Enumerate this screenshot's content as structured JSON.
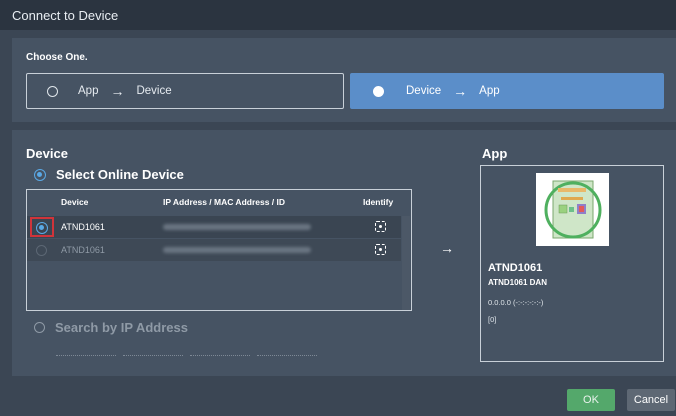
{
  "window": {
    "title": "Connect to Device"
  },
  "choose": {
    "label": "Choose One.",
    "app_to_device": {
      "from": "App",
      "to": "Device",
      "arrow": "→"
    },
    "device_to_app": {
      "from": "Device",
      "to": "App",
      "arrow": "→"
    }
  },
  "device_section": {
    "heading": "Device",
    "select_online_label": "Select Online Device",
    "table": {
      "columns": [
        "Device",
        "IP Address / MAC Address / ID",
        "Identify"
      ],
      "rows": [
        {
          "device": "ATND1061",
          "selected": true
        },
        {
          "device": "ATND1061",
          "selected": false
        }
      ]
    },
    "search_ip_label": "Search by IP Address"
  },
  "center_arrow": "→",
  "app_section": {
    "heading": "App",
    "card": {
      "title": "ATND1061",
      "subtitle": "ATND1061 DAN",
      "ip_line": "0.0.0.0 (-:-:-:-:-:-)",
      "index_line": "[0]"
    }
  },
  "footer": {
    "ok_label": "OK",
    "cancel_label": "Cancel"
  },
  "colors": {
    "accent": "#5b8ec9",
    "ok_green": "#54a86b",
    "selection_red": "#d0343a",
    "radio_blue": "#5aa9e6"
  }
}
